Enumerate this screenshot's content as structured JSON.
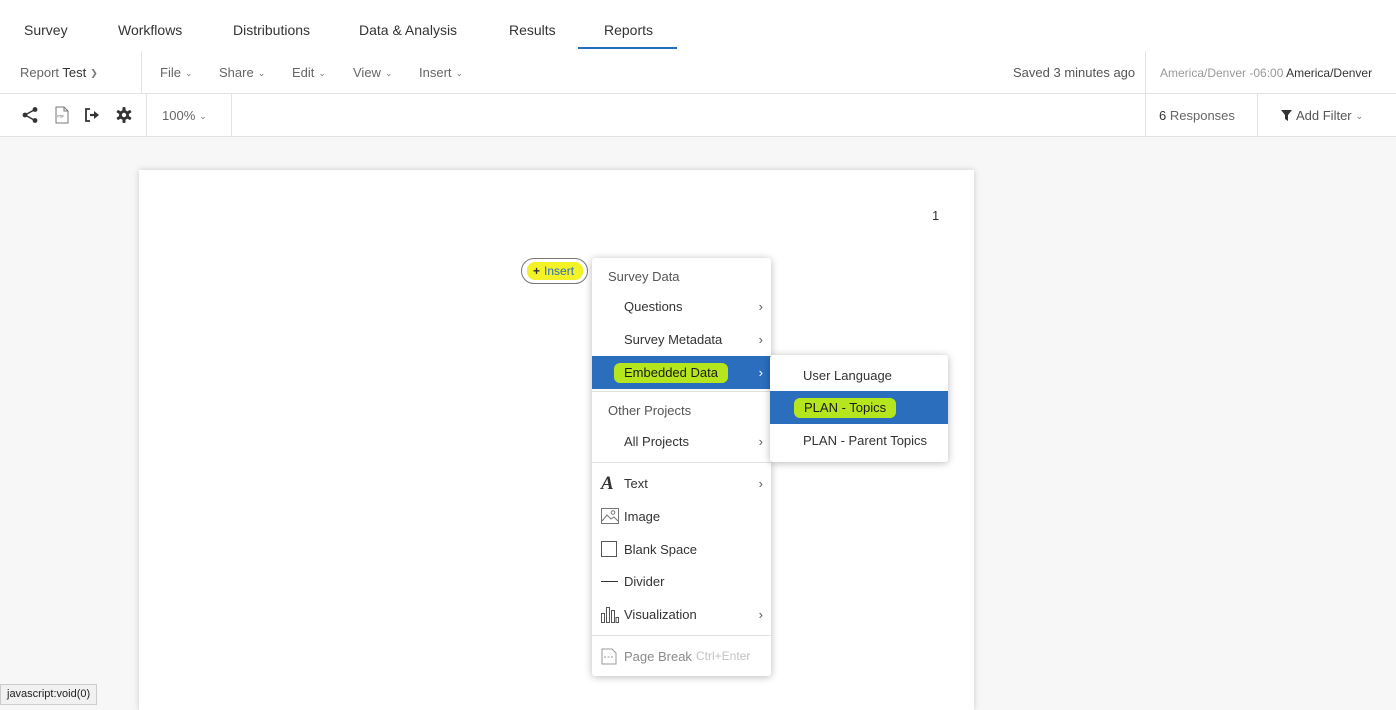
{
  "topnav": {
    "tabs": [
      "Survey",
      "Workflows",
      "Distributions",
      "Data & Analysis",
      "Results",
      "Reports"
    ],
    "active": "Reports"
  },
  "menubar": {
    "report_prefix": "Report",
    "report_name": "Test",
    "menus": [
      "File",
      "Share",
      "Edit",
      "View",
      "Insert"
    ],
    "saved_status": "Saved 3 minutes ago",
    "timezone_prefix": "America/Denver -06:00",
    "timezone_name": "America/Denver"
  },
  "toolbar": {
    "zoom": "100%",
    "responses_count": "6",
    "responses_label": "Responses",
    "filter_label": "Add Filter"
  },
  "page": {
    "number": "1",
    "insert_label": "Insert"
  },
  "insert_menu": {
    "section_survey": "Survey Data",
    "questions": "Questions",
    "survey_metadata": "Survey Metadata",
    "embedded_data": "Embedded Data",
    "section_other": "Other Projects",
    "all_projects": "All Projects",
    "text": "Text",
    "image": "Image",
    "blank_space": "Blank Space",
    "divider": "Divider",
    "visualization": "Visualization",
    "page_break": "Page Break",
    "page_break_shortcut": "Ctrl+Enter"
  },
  "embedded_submenu": {
    "items": [
      "User Language",
      "PLAN - Topics",
      "PLAN - Parent Topics"
    ],
    "selected": "PLAN - Topics"
  },
  "status_bar": "javascript:void(0)",
  "colors": {
    "accent_blue": "#2a6ebd",
    "highlight_yellow": "#f2f227",
    "highlight_green": "#b5e61d"
  }
}
